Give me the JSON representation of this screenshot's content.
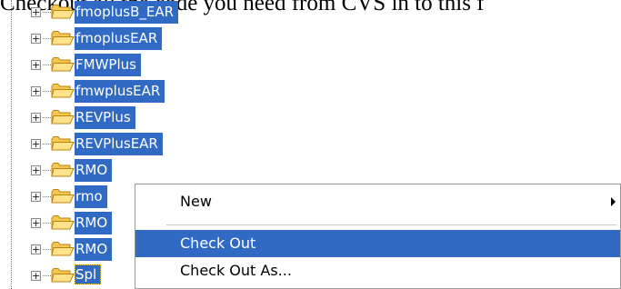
{
  "caption": "Checkout all the code you need from CVS in to this f",
  "tree": [
    {
      "label": "fmoplusB_EAR"
    },
    {
      "label": "fmoplusEAR"
    },
    {
      "label": "FMWPlus"
    },
    {
      "label": "fmwplusEAR"
    },
    {
      "label": "REVPlus"
    },
    {
      "label": "REVPlusEAR"
    },
    {
      "label": "RMO"
    },
    {
      "label": "rmo"
    },
    {
      "label": "RMO"
    },
    {
      "label": "RMO"
    },
    {
      "label": "Spl"
    }
  ],
  "context_menu": {
    "items": [
      {
        "label": "New",
        "has_submenu": true
      },
      {
        "label": "Check Out",
        "selected": true
      },
      {
        "label": "Check Out As..."
      }
    ]
  },
  "colors": {
    "selection": "#316ac5",
    "folder": "#ffd868"
  }
}
